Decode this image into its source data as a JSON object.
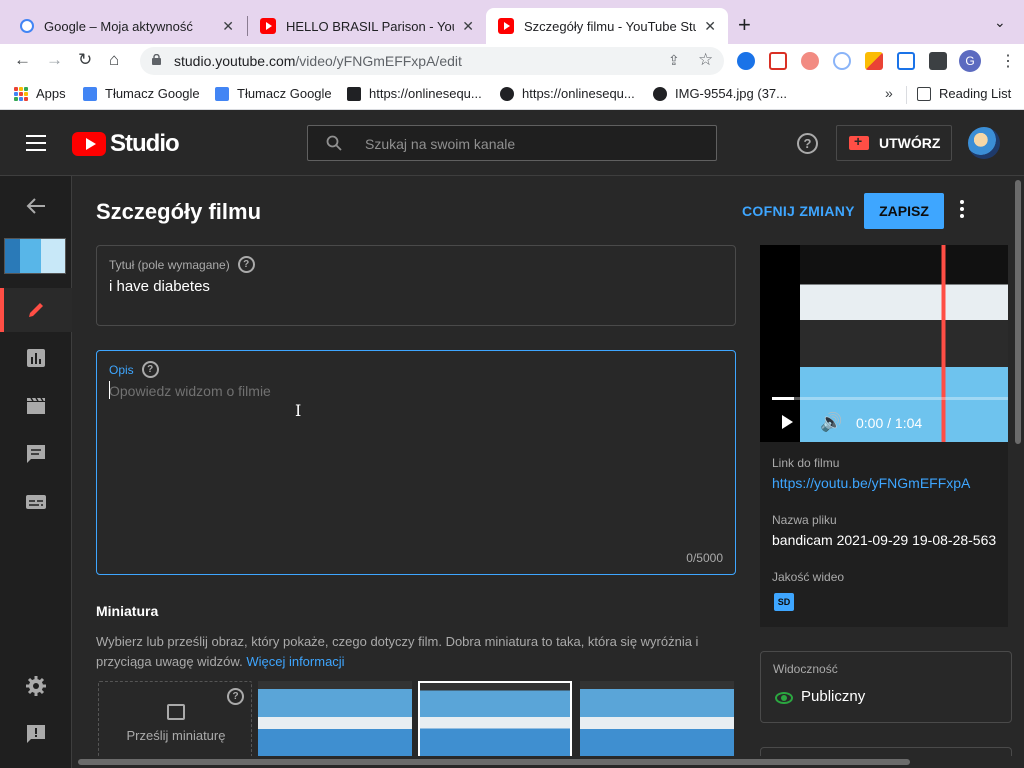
{
  "browser": {
    "tabs": [
      {
        "title": "Google – Moja aktywność",
        "favicon": "google-icon"
      },
      {
        "title": "HELLO BRASIL Parison - YouTu",
        "favicon": "youtube-icon"
      },
      {
        "title": "Szczegóły filmu - YouTube Stu",
        "favicon": "youtube-icon",
        "active": true
      }
    ],
    "url_host": "studio.youtube.com",
    "url_path": "/video/yFNGmEFFxpA/edit",
    "profile_initial": "G",
    "bookmarks": [
      {
        "label": "Apps",
        "icon": "apps-grid-icon"
      },
      {
        "label": "Tłumacz Google",
        "icon": "translate-icon"
      },
      {
        "label": "Tłumacz Google",
        "icon": "translate-icon"
      },
      {
        "label": "https://onlinesequ...",
        "icon": "sequencer-icon"
      },
      {
        "label": "https://onlinesequ...",
        "icon": "globe-icon"
      },
      {
        "label": "IMG-9554.jpg (37...",
        "icon": "globe-icon"
      }
    ],
    "reading_list": "Reading List"
  },
  "studio": {
    "logo_text": "Studio",
    "search_placeholder": "Szukaj na swoim kanale",
    "create_label": "UTWÓRZ",
    "page_title": "Szczegóły filmu",
    "undo_label": "COFNIJ ZMIANY",
    "save_label": "ZAPISZ",
    "title_field": {
      "label": "Tytuł (pole wymagane)",
      "value": "i have diabetes"
    },
    "description_field": {
      "label": "Opis",
      "placeholder": "Opowiedz widzom o filmie",
      "counter": "0/5000"
    },
    "thumbnail": {
      "heading": "Miniatura",
      "desc": "Wybierz lub prześlij obraz, który pokaże, czego dotyczy film. Dobra miniatura to taka, która się wyróżnia i przyciąga uwagę widzów.",
      "more_link": "Więcej informacji",
      "upload_label": "Prześlij miniaturę"
    },
    "player": {
      "time": "0:00 / 1:04"
    },
    "video_link_label": "Link do filmu",
    "video_link": "https://youtu.be/yFNGmEFFxpA",
    "filename_label": "Nazwa pliku",
    "filename": "bandicam 2021-09-29 19-08-28-563",
    "quality_label": "Jakość wideo",
    "quality_badge": "SD",
    "visibility_label": "Widoczność",
    "visibility_value": "Publiczny"
  },
  "colors": {
    "accent": "#3ea6ff",
    "brand_red": "#ff0000",
    "public_green": "#2ba640"
  }
}
